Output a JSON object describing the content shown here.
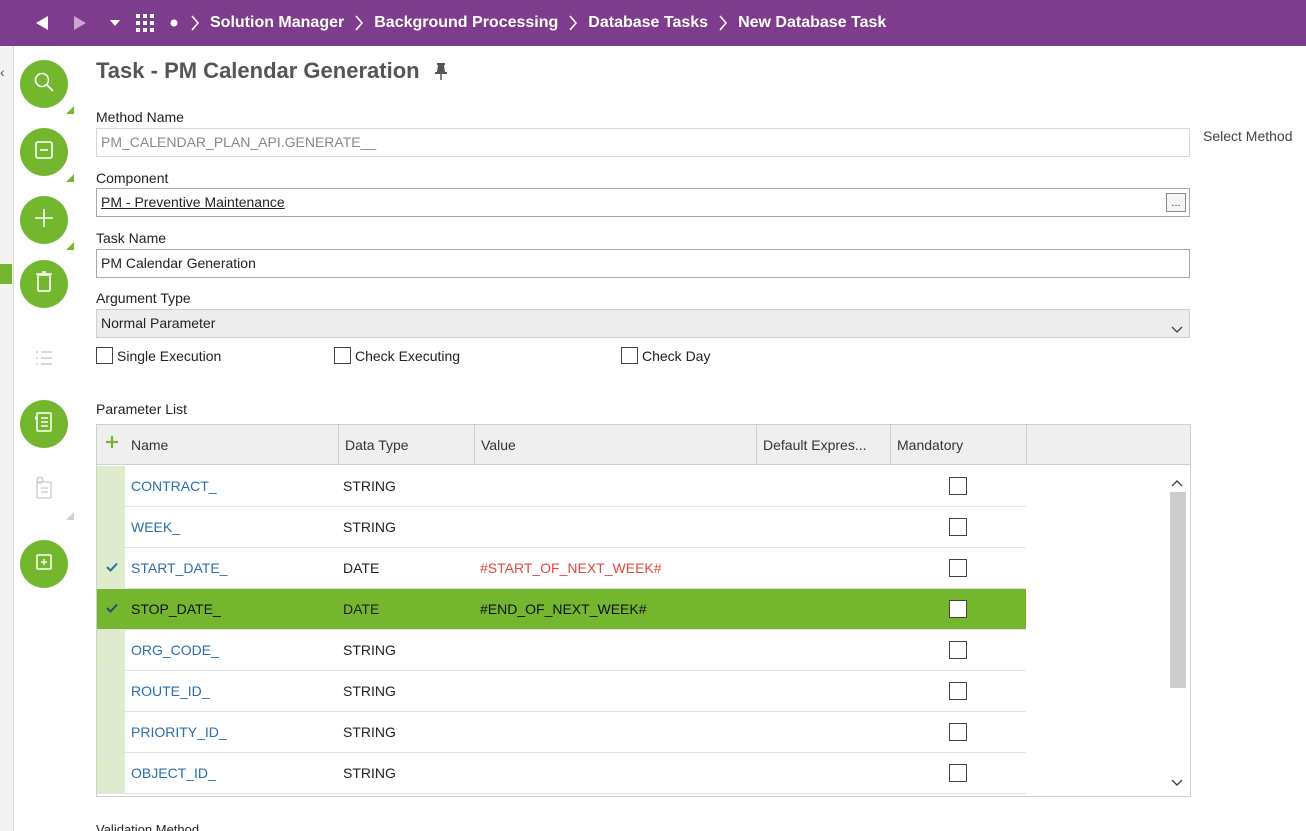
{
  "nav": {
    "breadcrumbs": [
      "Solution Manager",
      "Background Processing",
      "Database Tasks",
      "New Database Task"
    ]
  },
  "page": {
    "title": "Task - PM Calendar Generation"
  },
  "form": {
    "method_name": {
      "label": "Method Name",
      "value": "PM_CALENDAR_PLAN_API.GENERATE__"
    },
    "select_method_label": "Select Method",
    "component": {
      "label": "Component",
      "value": "PM - Preventive Maintenance",
      "lov_label": "..."
    },
    "task_name": {
      "label": "Task Name",
      "value": "PM Calendar Generation"
    },
    "argument_type": {
      "label": "Argument Type",
      "value": "Normal Parameter"
    },
    "checkboxes": {
      "single_execution": {
        "label": "Single Execution",
        "checked": false
      },
      "check_executing": {
        "label": "Check Executing",
        "checked": false
      },
      "check_day": {
        "label": "Check Day",
        "checked": false
      }
    }
  },
  "parameter_list": {
    "label": "Parameter List",
    "columns": [
      "Name",
      "Data Type",
      "Value",
      "Default Expres...",
      "Mandatory"
    ],
    "rows": [
      {
        "name": "CONTRACT_",
        "data_type": "STRING",
        "value": "",
        "checked_mark": false,
        "active": false,
        "mandatory": false
      },
      {
        "name": "WEEK_",
        "data_type": "STRING",
        "value": "",
        "checked_mark": false,
        "active": false,
        "mandatory": false
      },
      {
        "name": "START_DATE_",
        "data_type": "DATE",
        "value": "#START_OF_NEXT_WEEK#",
        "checked_mark": true,
        "active": false,
        "mandatory": false
      },
      {
        "name": "STOP_DATE_",
        "data_type": "DATE",
        "value": "#END_OF_NEXT_WEEK#",
        "checked_mark": true,
        "active": true,
        "mandatory": false
      },
      {
        "name": "ORG_CODE_",
        "data_type": "STRING",
        "value": "",
        "checked_mark": false,
        "active": false,
        "mandatory": false
      },
      {
        "name": "ROUTE_ID_",
        "data_type": "STRING",
        "value": "",
        "checked_mark": false,
        "active": false,
        "mandatory": false
      },
      {
        "name": "PRIORITY_ID_",
        "data_type": "STRING",
        "value": "",
        "checked_mark": false,
        "active": false,
        "mandatory": false
      },
      {
        "name": "OBJECT_ID_",
        "data_type": "STRING",
        "value": "",
        "checked_mark": false,
        "active": false,
        "mandatory": false
      }
    ]
  },
  "validation_method_label": "Validation Method",
  "colors": {
    "topbar": "#7d3c8c",
    "accent_green": "#74b72e",
    "link_blue": "#2a6fa8",
    "value_red": "#e04a3a"
  },
  "icons": {
    "toolbar": [
      "search-icon",
      "list-view-icon",
      "plus-icon",
      "delete-icon",
      "list-icon",
      "details-icon",
      "notes-icon",
      "duplicate-icon"
    ]
  }
}
